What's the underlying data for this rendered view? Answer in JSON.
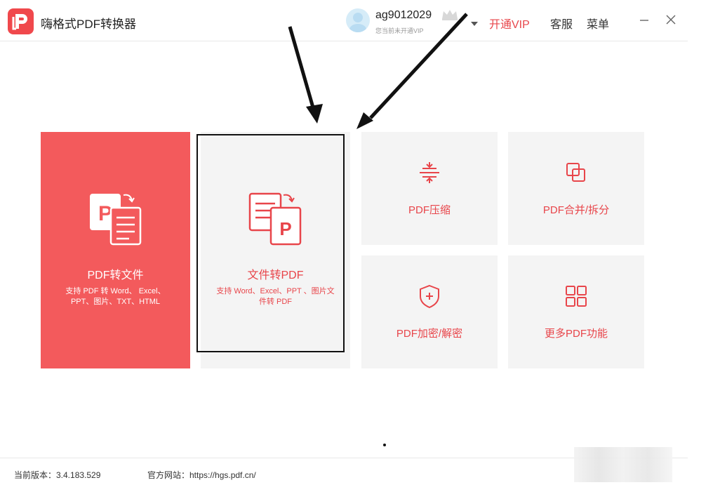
{
  "app": {
    "title": "嗨格式PDF转换器"
  },
  "user": {
    "name": "ag9012029",
    "vip_status": "您当前未开通VIP"
  },
  "header": {
    "open_vip": "开通VIP",
    "service": "客服",
    "menu": "菜单"
  },
  "cards": {
    "pdf_to_file": {
      "title": "PDF转文件",
      "desc": "支持 PDF 转 Word、 Excel、 PPT、图片、TXT、HTML"
    },
    "file_to_pdf": {
      "title": "文件转PDF",
      "desc": "支持 Word、Excel、PPT 、图片文件转 PDF"
    },
    "compress": {
      "label": "PDF压缩"
    },
    "merge": {
      "label": "PDF合并/拆分"
    },
    "encrypt": {
      "label": "PDF加密/解密"
    },
    "more": {
      "label": "更多PDF功能"
    }
  },
  "footer": {
    "version": "当前版本：3.4.183.529",
    "website": "官方网站：https://hgs.pdf.cn/"
  },
  "colors": {
    "accent": "#f0484c",
    "card_bg": "#f4f4f4"
  }
}
